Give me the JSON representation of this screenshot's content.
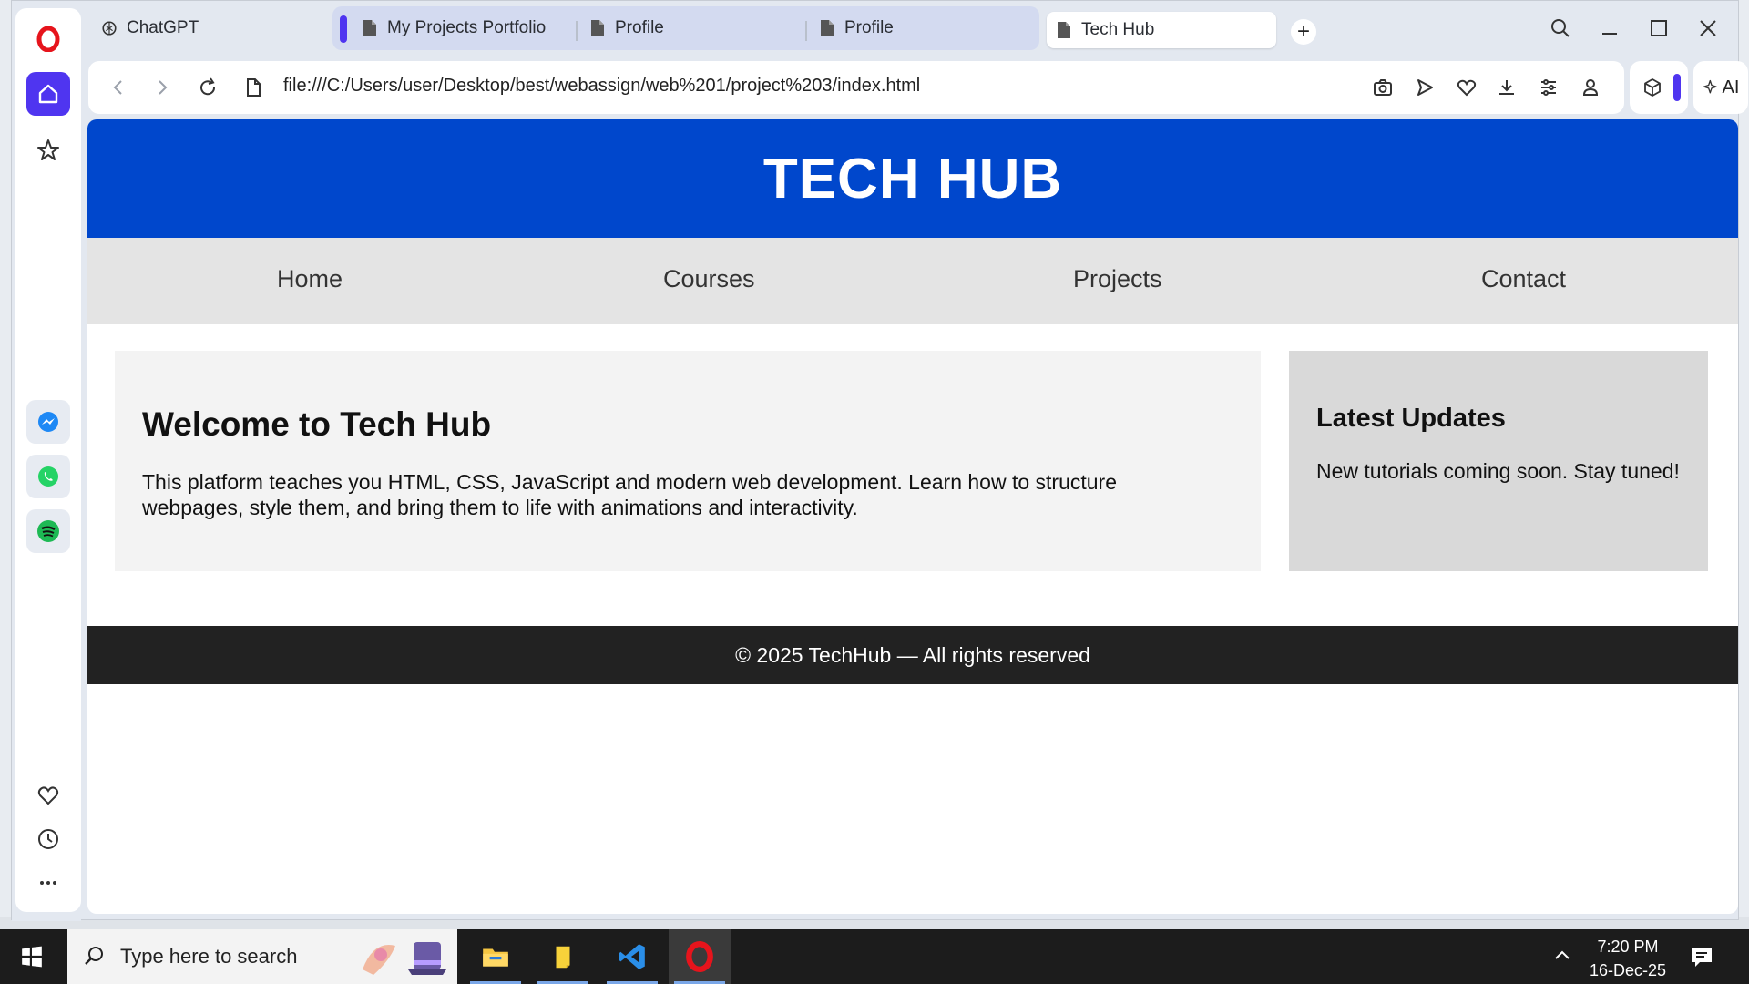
{
  "browser": {
    "tabs": [
      {
        "label": "ChatGPT",
        "icon": "chatgpt-icon"
      },
      {
        "label": "My Projects Portfolio",
        "icon": "page-icon"
      },
      {
        "label": "Profile",
        "icon": "page-icon"
      },
      {
        "label": "Profile",
        "icon": "page-icon"
      },
      {
        "label": "Tech Hub",
        "icon": "page-icon",
        "active": true
      }
    ],
    "new_tab_label": "+",
    "url": "file:///C:/Users/user/Desktop/best/webassign/web%201/project%203/index.html",
    "ai_label": "AI",
    "accent_color": "#4f35f0"
  },
  "site": {
    "title": "TECH HUB",
    "header_color": "#0047cc",
    "nav": [
      "Home",
      "Courses",
      "Projects",
      "Contact"
    ],
    "main": {
      "heading": "Welcome to Tech Hub",
      "text": "This platform teaches you HTML, CSS, JavaScript and modern web development. Learn how to structure webpages, style them, and bring them to life with animations and interactivity."
    },
    "aside": {
      "heading": "Latest Updates",
      "text": "New tutorials coming soon. Stay tuned!"
    },
    "footer": "© 2025 TechHub — All rights reserved"
  },
  "taskbar": {
    "search_placeholder": "Type here to search",
    "time": "7:20 PM",
    "date": "16-Dec-25"
  }
}
